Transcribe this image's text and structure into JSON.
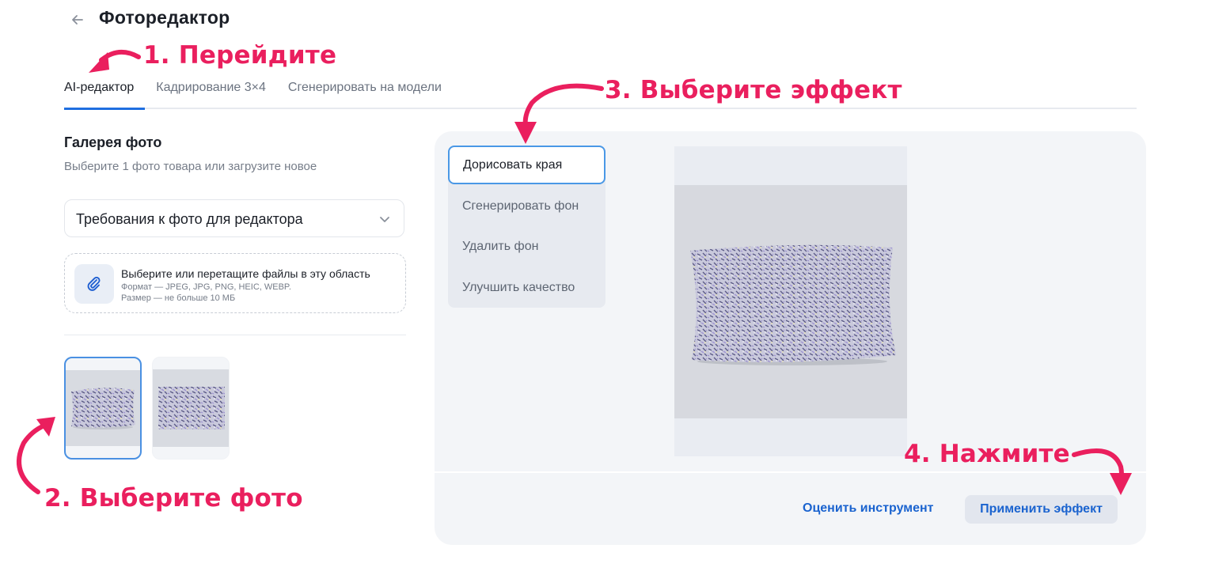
{
  "header": {
    "title": "Фоторедактор",
    "back_icon": "arrow-left-icon"
  },
  "tabs": [
    {
      "label": "AI-редактор",
      "active": true
    },
    {
      "label": "Кадрирование 3×4",
      "active": false
    },
    {
      "label": "Сгенерировать на модели",
      "active": false
    }
  ],
  "gallery": {
    "title": "Галерея фото",
    "subtitle": "Выберите 1 фото товара или загрузите новое",
    "requirements_select": "Требования к фото для редактора",
    "upload": {
      "title": "Выберите или перетащите файлы в эту область",
      "format": "Формат — JPEG, JPG, PNG, HEIC, WEBP.",
      "size": "Размер — не больше 10 МБ",
      "icon": "paperclip-icon"
    },
    "thumbnails": [
      {
        "selected": true
      },
      {
        "selected": false
      }
    ]
  },
  "effects": [
    {
      "label": "Дорисовать края",
      "active": true
    },
    {
      "label": "Сгенерировать фон",
      "active": false
    },
    {
      "label": "Удалить фон",
      "active": false
    },
    {
      "label": "Улучшить качество",
      "active": false
    }
  ],
  "actions": {
    "rate": "Оценить инструмент",
    "apply": "Применить эффект"
  },
  "annotations": {
    "step1": "1. Перейдите",
    "step2": "2. Выберите фото",
    "step3": "3. Выберите эффект",
    "step4": "4. Нажмите",
    "color": "#ea1f5e"
  },
  "colors": {
    "accent": "#1f6fe0",
    "link": "#1a63cf",
    "panel": "#f3f5f8"
  }
}
